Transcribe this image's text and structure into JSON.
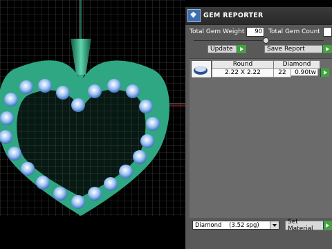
{
  "panel": {
    "title": "GEM REPORTER",
    "total_gem_weight_label": "Total Gem Weight",
    "total_gem_weight_value": "90",
    "total_gem_count_label": "Total Gem Count",
    "update_label": "Update",
    "save_report_label": "Save Report",
    "table": {
      "headers": [
        "Round",
        "Diamond"
      ],
      "row": {
        "size": "2.22 X 2.22",
        "count": "22",
        "weight": "0.90tw"
      }
    },
    "material_select": "Diamond    (3.52 spg)",
    "set_material_label": "Set Material"
  },
  "colors": {
    "gem_metal": "#2fa783",
    "gem_stone": "#9ec4f2",
    "accent_green": "#3fa53a",
    "panel_bg": "#595959"
  }
}
